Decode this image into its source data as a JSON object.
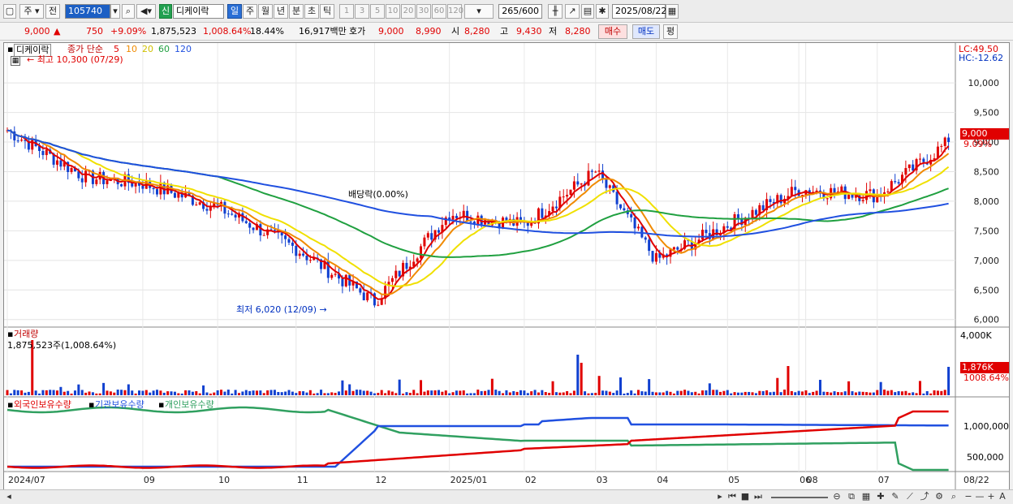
{
  "toolbar": {
    "period_unit": "주",
    "prev_label": "전",
    "stock_code": "105740",
    "badge": "신",
    "stock_name": "디케이락",
    "tabs": [
      "일",
      "주",
      "월",
      "년",
      "분",
      "초",
      "틱"
    ],
    "active_tab": "일",
    "intervals": [
      "1",
      "3",
      "5",
      "10",
      "20",
      "30",
      "60",
      "120"
    ],
    "count": "265",
    "count_total": "/600",
    "date": "2025/08/22"
  },
  "quote": {
    "price": "9,000",
    "arrow": "▲",
    "change": "750",
    "change_pct": "+9.09%",
    "volume": "1,875,523",
    "volume_ratio": "1,008.64%",
    "turnover": "18.44%",
    "amount": "16,917백만",
    "bid_label": "호가",
    "bid1": "9,000",
    "bid2": "8,990",
    "open_label": "시",
    "open": "8,280",
    "high_label": "고",
    "high": "9,430",
    "low_label": "저",
    "low": "8,280",
    "buy_label": "매수",
    "sell_label": "매도",
    "eval_label": "평"
  },
  "price_panel": {
    "title": "디케이락",
    "ma_label": "종가 단순",
    "ma_periods": [
      "5",
      "10",
      "20",
      "60",
      "120"
    ],
    "high_marker": "최고 10,300 (07/29)",
    "low_marker": "최저 6,020 (12/09)",
    "dividend_marker": "배당락(0.00%)",
    "lc": "LC:49.50",
    "hc": "HC:-12.62",
    "price_tag": "9,000",
    "pct_tag": "9.09%",
    "y_ticks": [
      "10,000",
      "9,500",
      "9,000",
      "8,500",
      "8,000",
      "7,500",
      "7,000",
      "6,500",
      "6,000"
    ]
  },
  "volume_panel": {
    "title": "거래량",
    "value": "1,875,523주(1,008.64%)",
    "y_tick": "4,000K",
    "tag": "1,876K",
    "tag_pct": "1008.64%"
  },
  "holding_panel": {
    "legend": [
      "외국인보유수량",
      "기관보유수량",
      "개인보유수량"
    ],
    "y_ticks": [
      "1,000,000",
      "500,000"
    ]
  },
  "x_axis": [
    "2024/07",
    "09",
    "10",
    "11",
    "12",
    "2025/01",
    "02",
    "03",
    "04",
    "05",
    "06",
    "07",
    "08",
    "08/22"
  ],
  "colors": {
    "up": "#e00000",
    "down": "#1040d0",
    "ma5": "#e00000",
    "ma10": "#f08a00",
    "ma20": "#f0e000",
    "ma60": "#20a040",
    "ma120": "#2050e0",
    "foreign": "#e00000",
    "institution": "#2050e0",
    "individual": "#30a060"
  },
  "chart_data": {
    "type": "candlestick",
    "title": "디케이락",
    "price_range": [
      5900,
      10400
    ],
    "monthly_close": {
      "categories": [
        "2024/07",
        "08",
        "09",
        "10",
        "11",
        "12",
        "2025/01",
        "02",
        "03",
        "04",
        "05",
        "06",
        "07",
        "08/22"
      ],
      "values": [
        9200,
        8400,
        8300,
        7900,
        7200,
        6300,
        7800,
        7600,
        8500,
        7000,
        7600,
        8200,
        8100,
        9000
      ]
    }
  }
}
